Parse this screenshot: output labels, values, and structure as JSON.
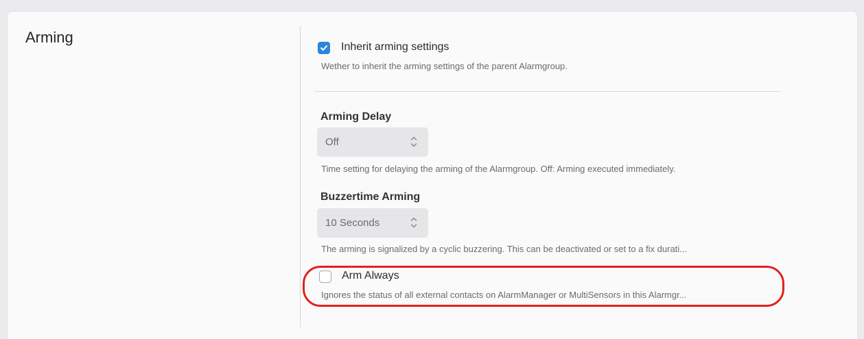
{
  "section": {
    "title": "Arming"
  },
  "inherit": {
    "label": "Inherit arming settings",
    "checked": true,
    "help": "Wether to inherit the arming settings of the parent Alarmgroup."
  },
  "arming_delay": {
    "label": "Arming Delay",
    "value": "Off",
    "help": "Time setting for delaying the arming of the Alarmgroup. Off: Arming executed immediately."
  },
  "buzzertime": {
    "label": "Buzzertime Arming",
    "value": "10 Seconds",
    "help": "The arming is signalized by a cyclic buzzering. This can be deactivated or set to a fix durati..."
  },
  "arm_always": {
    "label": "Arm Always",
    "checked": false,
    "help": "Ignores the status of all external contacts on AlarmManager or MultiSensors in this Alarmgr..."
  },
  "colors": {
    "accent": "#2d86d9",
    "highlight": "#e4201c"
  },
  "icons": [
    "checkmark-icon",
    "select-chevron-icon"
  ]
}
